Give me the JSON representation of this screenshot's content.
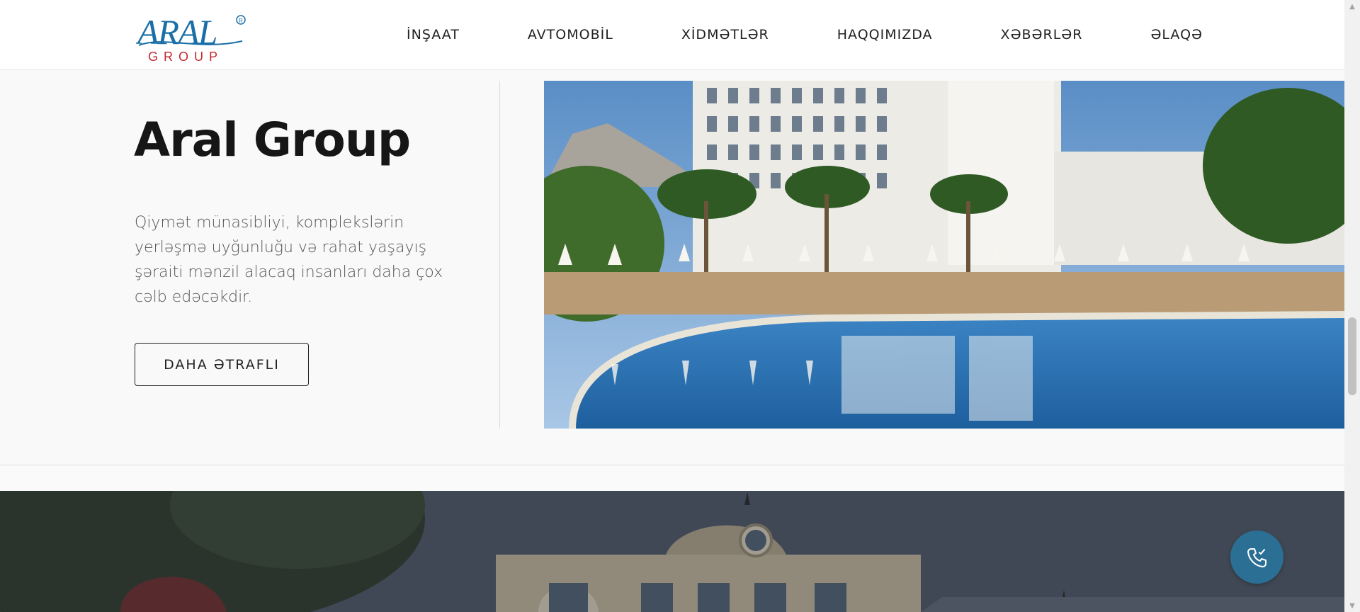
{
  "brand": {
    "name": "ARAL",
    "sub": "GROUP",
    "registered": "®",
    "primary_color": "#1a6fa8",
    "accent_color": "#c0282d"
  },
  "nav": {
    "items": [
      {
        "label": "İNŞAAT"
      },
      {
        "label": "AVTOMOBİL"
      },
      {
        "label": "XİDMƏTLƏR"
      },
      {
        "label": "HAQQIMIZDA"
      },
      {
        "label": "XƏBƏRLƏR"
      },
      {
        "label": "ƏLAQƏ"
      }
    ]
  },
  "hero": {
    "title": "Aral Group",
    "description": "Qiymət münasibliyi, komplekslərin yerləşmə uyğunluğu və rahat yaşayış şəraiti mənzil alacaq insanları daha çox cəlb edəcəkdir.",
    "button_label": "DAHA ƏTRAFLI"
  },
  "floating": {
    "call_icon": "phone-call-icon",
    "color": "#2c6f94"
  }
}
